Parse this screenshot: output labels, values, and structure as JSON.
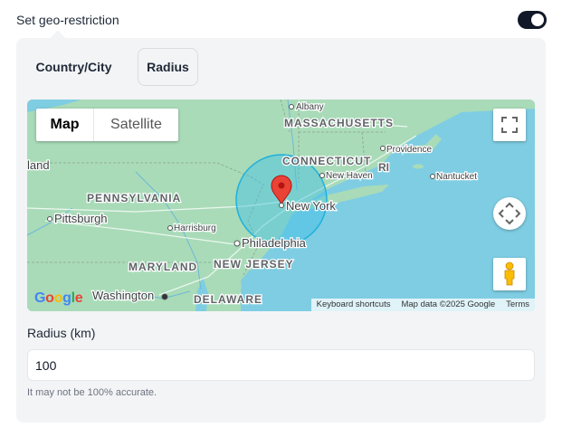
{
  "header": {
    "title": "Set geo-restriction",
    "toggle_on": true
  },
  "tabs": [
    {
      "label": "Country/City",
      "selected": false
    },
    {
      "label": "Radius",
      "selected": true
    }
  ],
  "map": {
    "type_control": {
      "map_label": "Map",
      "satellite_label": "Satellite",
      "selected": "Map"
    },
    "labels": {
      "albany": "Albany",
      "massachusetts": "MASSACHUSETTS",
      "providence": "Providence",
      "connecticut": "CONNECTICUT",
      "ri": "RI",
      "new_haven": "New Haven",
      "nantucket": "Nantucket",
      "land": "land",
      "pennsylvania": "PENNSYLVANIA",
      "pittsburgh": "Pittsburgh",
      "harrisburg": "Harrisburg",
      "new_york": "New York",
      "philadelphia": "Philadelphia",
      "maryland": "MARYLAND",
      "new_jersey": "NEW JERSEY",
      "washington": "Washington",
      "delaware": "DELAWARE"
    },
    "google_logo": "Google",
    "attribution": {
      "shortcuts": "Keyboard shortcuts",
      "data": "Map data ©2025 Google",
      "terms": "Terms"
    },
    "colors": {
      "water": "#7fcde3",
      "land": "#a9dbb8",
      "circle": "#3ec1e6",
      "marker": "#ea4335"
    }
  },
  "radius": {
    "label": "Radius (km)",
    "value": "100",
    "hint": "It may not be 100% accurate."
  }
}
